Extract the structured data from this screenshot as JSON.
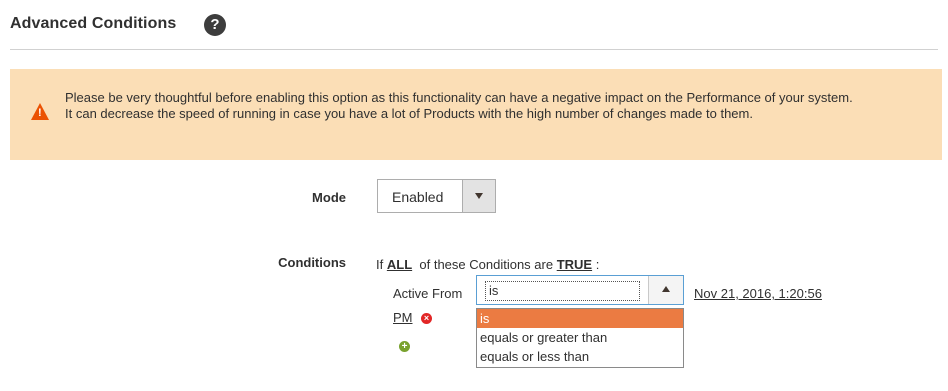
{
  "section": {
    "title": "Advanced Conditions",
    "help_glyph": "?"
  },
  "notice": {
    "line1": "Please be very thoughtful before enabling this option as this functionality can have a negative impact on the Performance of your system.",
    "line2": "It can decrease the speed of running in case you have a lot of Products with the high number of changes made to them.",
    "icon": "warning-icon",
    "background": "#fbdeb6",
    "icon_color": "#eb5202"
  },
  "mode": {
    "label": "Mode",
    "value": "Enabled"
  },
  "conditions": {
    "label": "Conditions",
    "prefix": "If",
    "aggregator": "ALL",
    "middle": "of these Conditions are",
    "value": "TRUE",
    "suffix": ":",
    "rule": {
      "attribute": "Active From",
      "operator": "is",
      "date_value": "Nov 21, 2016, 1:20:56",
      "date_value_cont": "PM"
    },
    "operator_options": [
      "is",
      "equals or greater than",
      "equals or less than"
    ],
    "selected_option_color": "#eb7b42"
  }
}
